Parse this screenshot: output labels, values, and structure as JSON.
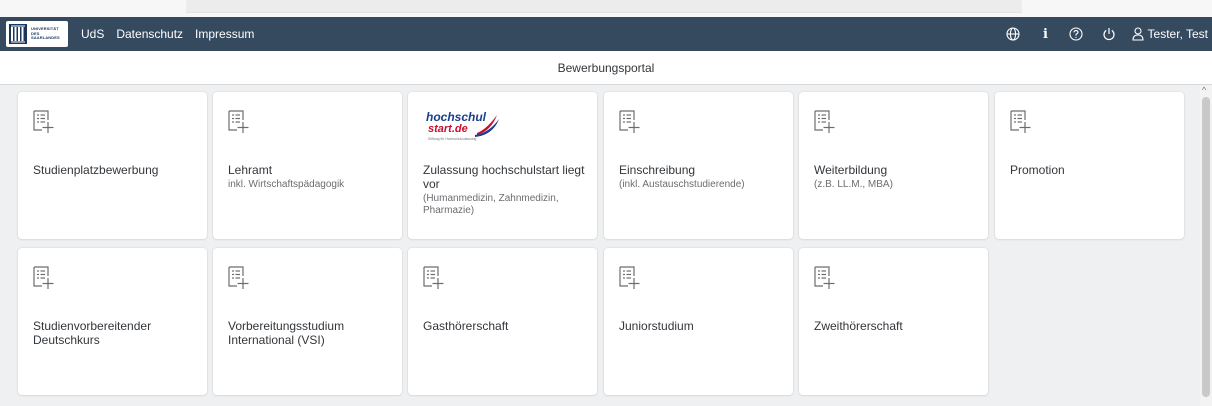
{
  "shell": {
    "logo_text": [
      "UNIVERSITÄT",
      "DES",
      "SAARLANDES"
    ],
    "nav": [
      "UdS",
      "Datenschutz",
      "Impressum"
    ],
    "icons": [
      "globe-icon",
      "info-icon",
      "help-icon",
      "power-icon",
      "user-icon"
    ],
    "info_glyph": "i",
    "user_name": "Tester, Test",
    "bg_color": "#354a5f"
  },
  "page": {
    "title": "Bewerbungsportal"
  },
  "tiles": [
    {
      "title": "Studienplatzbewerbung",
      "subtitle": ""
    },
    {
      "title": "Lehramt",
      "subtitle": "inkl. Wirtschaftspädagogik"
    },
    {
      "title": "Zulassung hochschulstart liegt vor",
      "subtitle": "(Humanmedizin, Zahnmedizin, Pharmazie)",
      "logo": {
        "line1": "hochschul",
        "line2": "start.de",
        "tagline": "Stiftung für Hochschulzulassung"
      }
    },
    {
      "title": "Einschreibung",
      "subtitle": "(inkl. Austauschstudierende)"
    },
    {
      "title": "Weiterbildung",
      "subtitle": "(z.B. LL.M., MBA)"
    },
    {
      "title": "Promotion",
      "subtitle": ""
    },
    {
      "title": "Studienvorbereitender Deutschkurs",
      "subtitle": ""
    },
    {
      "title": "Vorbereitungsstudium International (VSI)",
      "subtitle": ""
    },
    {
      "title": "Gasthörerschaft",
      "subtitle": ""
    },
    {
      "title": "Juniorstudium",
      "subtitle": ""
    },
    {
      "title": "Zweithörerschaft",
      "subtitle": ""
    }
  ]
}
